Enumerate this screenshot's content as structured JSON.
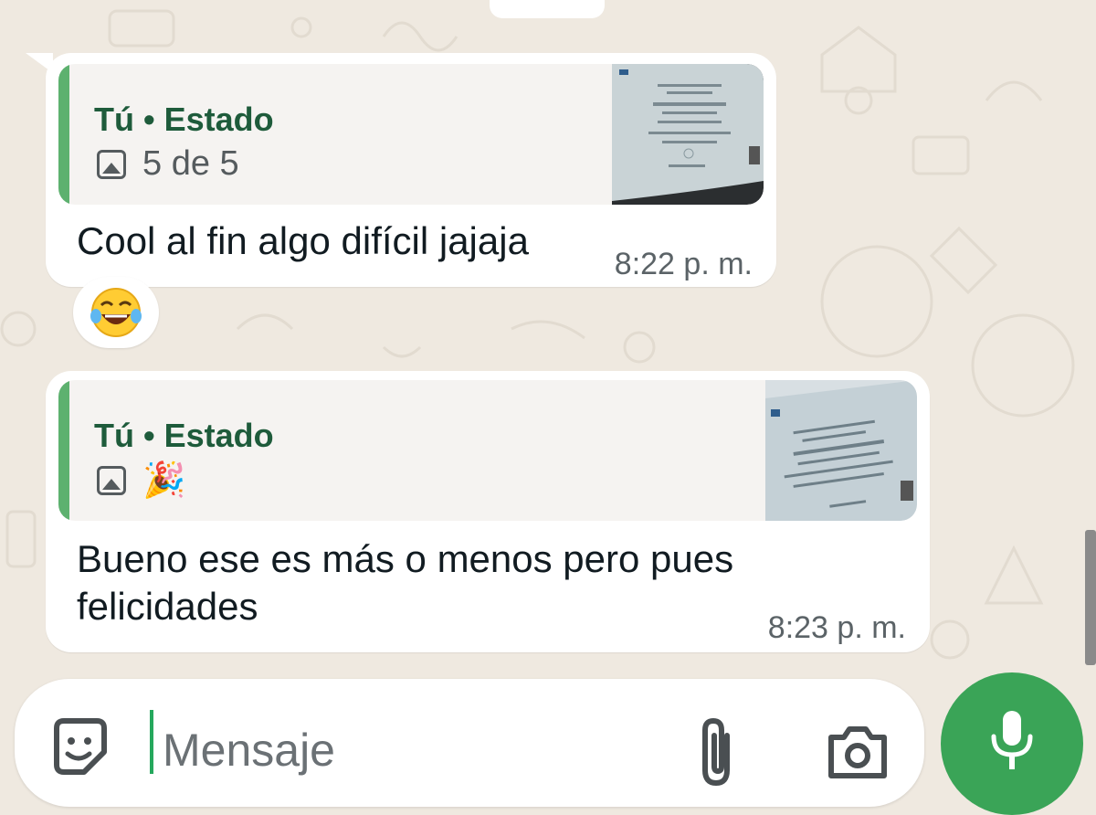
{
  "colors": {
    "wallpaper": "#efe9e0",
    "bubble": "#ffffff",
    "quote_bar": "#5db16f",
    "quote_title": "#1e5b3b",
    "mic_button": "#3aa457"
  },
  "messages": [
    {
      "quote": {
        "title": "Tú • Estado",
        "media_icon": "image-icon",
        "caption": "5 de 5"
      },
      "text": "Cool al fin algo difícil jajaja",
      "time": "8:22 p. m.",
      "reaction": "😂"
    },
    {
      "quote": {
        "title": "Tú • Estado",
        "media_icon": "image-icon",
        "caption": "🎉"
      },
      "text": "Bueno ese es más o menos pero pues felicidades",
      "time": "8:23 p. m."
    }
  ],
  "composer": {
    "placeholder": "Mensaje",
    "icons": [
      "sticker-icon",
      "paperclip-icon",
      "camera-icon",
      "microphone-icon"
    ]
  }
}
